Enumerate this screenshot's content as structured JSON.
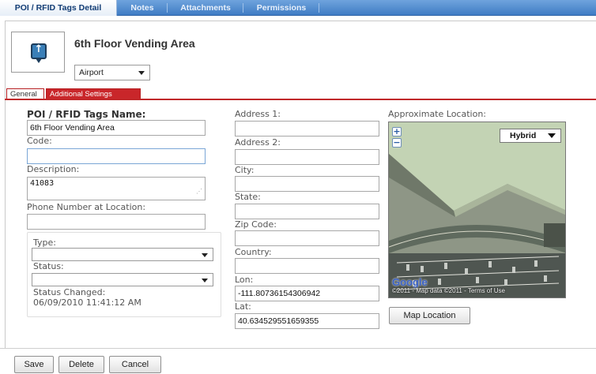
{
  "top_tabs": [
    {
      "label": "POI / RFID Tags Detail",
      "active": true
    },
    {
      "label": "Notes",
      "active": false
    },
    {
      "label": "Attachments",
      "active": false
    },
    {
      "label": "Permissions",
      "active": false
    }
  ],
  "header": {
    "title": "6th Floor Vending Area",
    "category_select": "Airport"
  },
  "sub_tabs": [
    {
      "label": "General",
      "active": true
    },
    {
      "label": "Additional Settings",
      "active": false
    }
  ],
  "general": {
    "name_label": "POI / RFID Tags Name:",
    "name_value": "6th Floor Vending Area",
    "code_label": "Code:",
    "code_value": "",
    "description_label": "Description:",
    "description_value": "41083",
    "phone_label": "Phone Number at Location:",
    "phone_value": "",
    "type_label": "Type:",
    "type_value": "",
    "status_label": "Status:",
    "status_value": "",
    "status_changed_label": "Status Changed:",
    "status_changed_value": "06/09/2010 11:41:12 AM"
  },
  "address": {
    "address1_label": "Address 1:",
    "address1_value": "",
    "address2_label": "Address 2:",
    "address2_value": "",
    "city_label": "City:",
    "city_value": "",
    "state_label": "State:",
    "state_value": "",
    "zip_label": "Zip Code:",
    "zip_value": "",
    "country_label": "Country:",
    "country_value": "",
    "lon_label": "Lon:",
    "lon_value": "-111.80736154306942",
    "lat_label": "Lat:",
    "lat_value": "40.634529551659355"
  },
  "map": {
    "label": "Approximate Location:",
    "zoom_in": "+",
    "zoom_out": "−",
    "map_type": "Hybrid",
    "logo": "Google",
    "attribution": "©2011 - Map data ©2011 - Terms of Use",
    "map_location_button": "Map Location"
  },
  "footer": {
    "save": "Save",
    "delete": "Delete",
    "cancel": "Cancel"
  },
  "colors": {
    "tab_bar": "#4f8ccf",
    "sub_tab_red": "#c9262a"
  },
  "icons": {
    "poi_icon": "map-pin-icon",
    "dropdown": "chevron-down-icon"
  }
}
